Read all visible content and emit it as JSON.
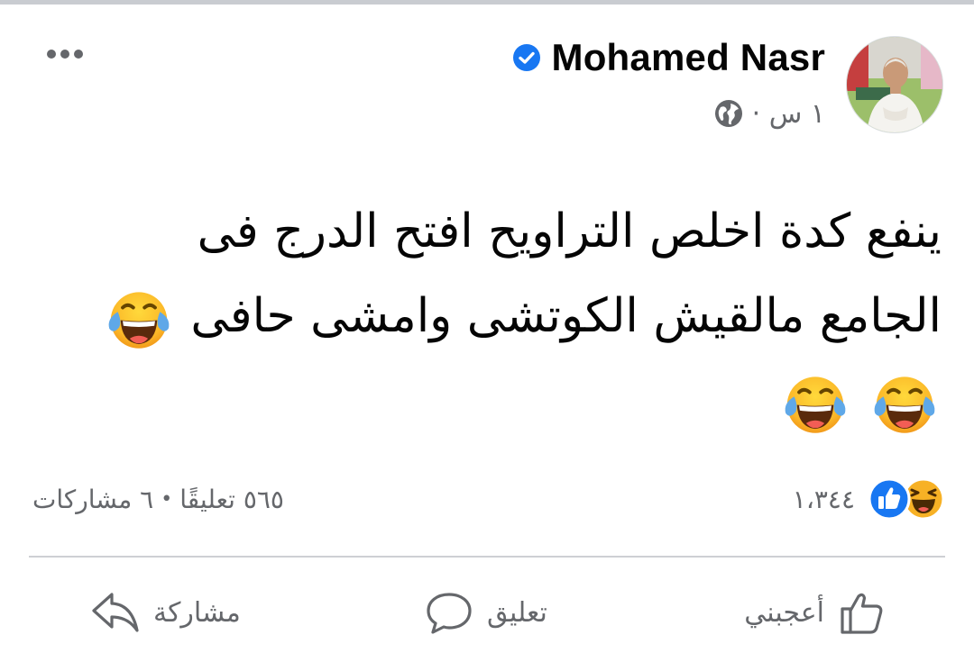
{
  "post": {
    "author": "Mohamed Nasr",
    "time": "١ س ·",
    "text_lines": [
      "ينفع كدة اخلص التراويح افتح الدرج فى",
      "الجامع مالقيش الكوتشى وامشى حافى"
    ]
  },
  "reactions": {
    "count": "١،٣٤٤"
  },
  "stats": {
    "comments": "٥٦٥ تعليقًا",
    "separator": "•",
    "shares": "٦ مشاركات"
  },
  "actions": {
    "like": "أعجبني",
    "comment": "تعليق",
    "share": "مشاركة"
  },
  "icons": {
    "more": "more-dots-icon",
    "verified": "verified-badge-icon",
    "audience": "globe-icon",
    "like_reaction": "like-reaction-icon",
    "haha_reaction": "haha-reaction-icon",
    "tears_of_joy": "tears-of-joy-emoji",
    "like_action": "thumbs-up-icon",
    "comment_action": "comment-bubble-icon",
    "share_action": "share-arrow-icon"
  },
  "colors": {
    "verified": "#1877f2",
    "like": "#1877f2",
    "haha": "#f7b125",
    "secondary_text": "#65676b"
  }
}
